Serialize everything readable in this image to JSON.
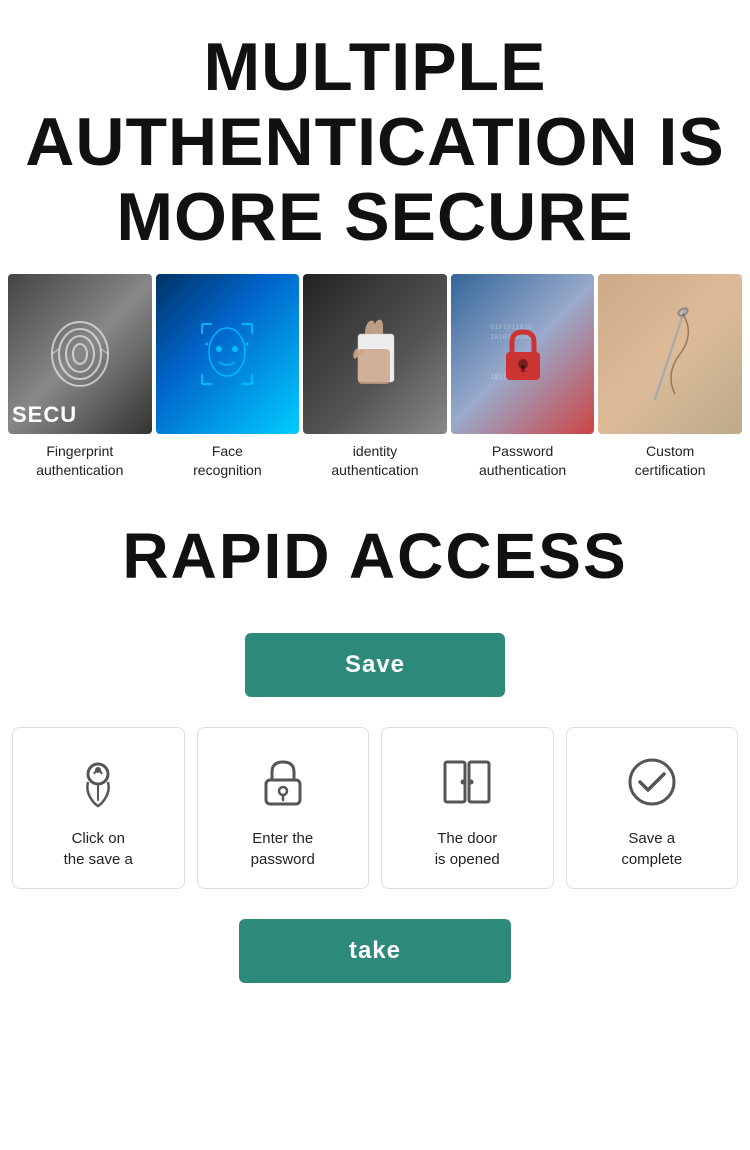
{
  "header": {
    "title_line1": "MULTIPLE",
    "title_line2": "AUTHENTICATION IS",
    "title_line3": "MORE SECURE"
  },
  "auth_methods": [
    {
      "id": "fingerprint",
      "label_line1": "Fingerprint",
      "label_line2": "authentication",
      "img_class": "img-fingerprint",
      "overlay_text": "SECU"
    },
    {
      "id": "face",
      "label_line1": "Face",
      "label_line2": "recognition",
      "img_class": "img-face",
      "overlay_text": ""
    },
    {
      "id": "identity",
      "label_line1": "identity",
      "label_line2": "authentication",
      "img_class": "img-identity",
      "overlay_text": ""
    },
    {
      "id": "password",
      "label_line1": "Password",
      "label_line2": "authentication",
      "img_class": "img-password",
      "overlay_text": ""
    },
    {
      "id": "custom",
      "label_line1": "Custom",
      "label_line2": "certification",
      "img_class": "img-custom",
      "overlay_text": ""
    }
  ],
  "rapid_access": {
    "title": "RAPID ACCESS"
  },
  "save_button": {
    "label": "Save"
  },
  "steps": [
    {
      "id": "click-save",
      "icon": "hand",
      "label_line1": "Click on",
      "label_line2": "the save a"
    },
    {
      "id": "enter-password",
      "icon": "lock",
      "label_line1": "Enter the",
      "label_line2": "password"
    },
    {
      "id": "door-opened",
      "icon": "door",
      "label_line1": "The door",
      "label_line2": "is opened"
    },
    {
      "id": "save-complete",
      "icon": "check",
      "label_line1": "Save a",
      "label_line2": "complete"
    }
  ],
  "take_button": {
    "label": "take"
  }
}
